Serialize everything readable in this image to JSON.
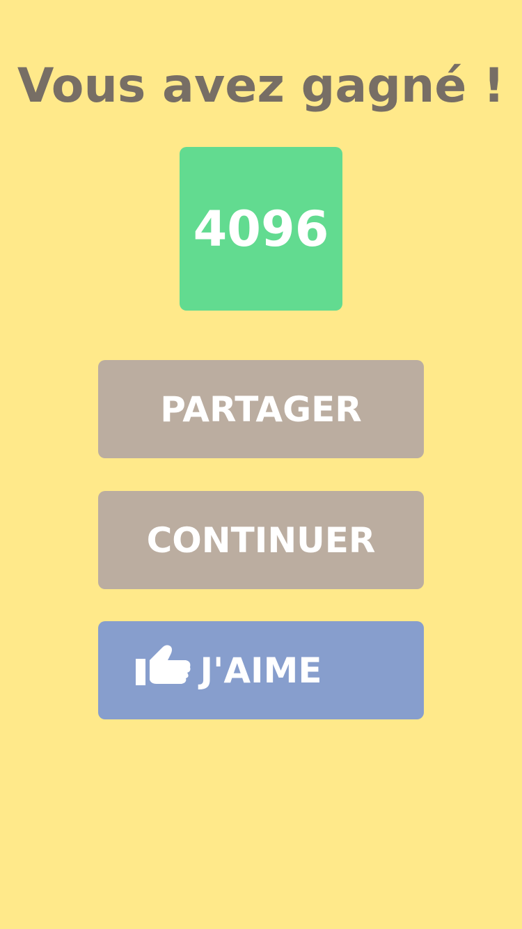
{
  "dialog": {
    "title": "Vous avez gagné !"
  },
  "tile": {
    "value": "4096",
    "color": "#62db90"
  },
  "buttons": {
    "share_label": "PARTAGER",
    "continue_label": "CONTINUER",
    "like_label": "J'AIME",
    "like_icon": "thumbs-up-icon"
  },
  "colors": {
    "background": "#ffe98a",
    "title_text": "#776e65",
    "neutral_button": "#bbada0",
    "like_button": "#879ecd"
  }
}
